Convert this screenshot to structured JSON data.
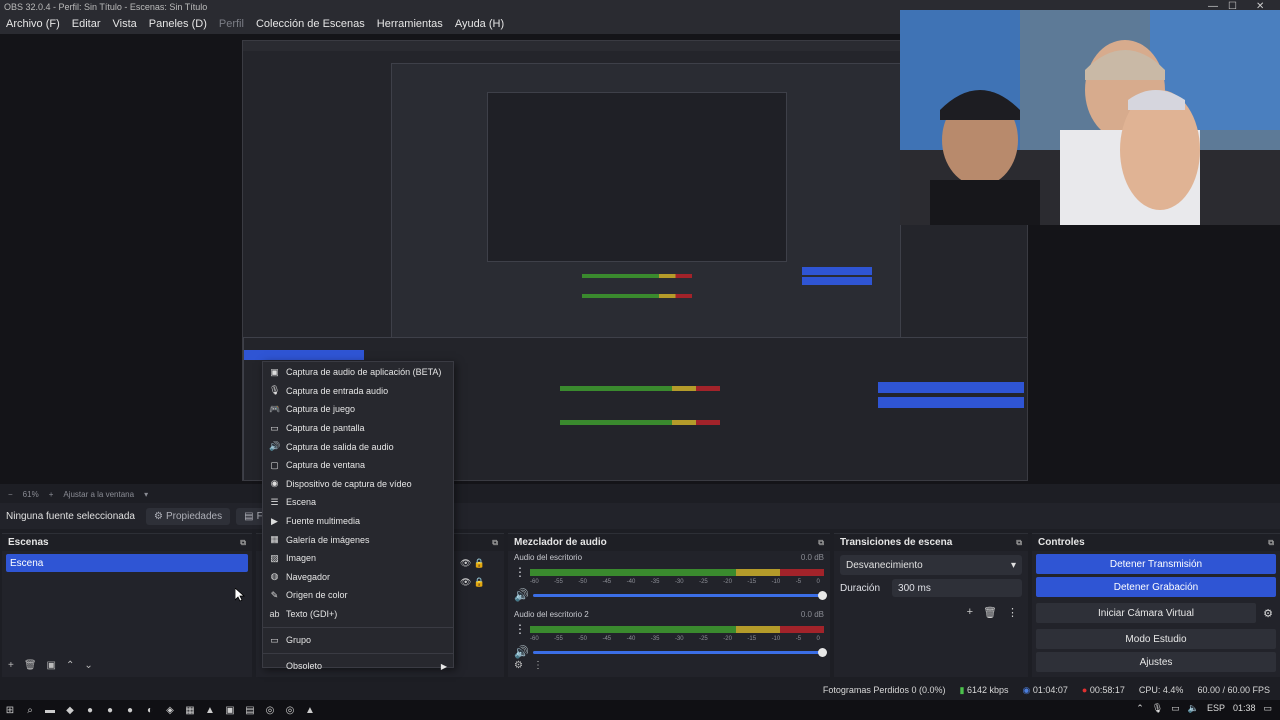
{
  "window": {
    "title": "OBS 32.0.4 - Perfil: Sin Título - Escenas: Sin Título"
  },
  "menubar": {
    "items": [
      {
        "label": "Archivo (F)",
        "dim": false
      },
      {
        "label": "Editar",
        "dim": false
      },
      {
        "label": "Vista",
        "dim": false
      },
      {
        "label": "Paneles (D)",
        "dim": false
      },
      {
        "label": "Perfil",
        "dim": true
      },
      {
        "label": "Colección de Escenas",
        "dim": false
      },
      {
        "label": "Herramientas",
        "dim": false
      },
      {
        "label": "Ayuda (H)",
        "dim": false
      }
    ]
  },
  "preview": {
    "zoom": "61%",
    "fit_label": "Ajustar a la ventana"
  },
  "properties_bar": {
    "no_source": "Ninguna fuente seleccionada",
    "properties_btn": "Propiedades",
    "filters_btn": "Filtros"
  },
  "scenes": {
    "title": "Escenas",
    "items": [
      "Escena"
    ]
  },
  "context_menu": {
    "items": [
      {
        "label": "Captura de audio de aplicación (BETA)",
        "icon": "app-audio-icon"
      },
      {
        "label": "Captura de entrada audio",
        "icon": "microphone-icon"
      },
      {
        "label": "Captura de juego",
        "icon": "gamepad-icon"
      },
      {
        "label": "Captura de pantalla",
        "icon": "monitor-icon"
      },
      {
        "label": "Captura de salida de audio",
        "icon": "speaker-icon"
      },
      {
        "label": "Captura de ventana",
        "icon": "window-icon"
      },
      {
        "label": "Dispositivo de captura de vídeo",
        "icon": "camera-icon"
      },
      {
        "label": "Escena",
        "icon": "list-icon"
      },
      {
        "label": "Fuente multimedia",
        "icon": "play-icon"
      },
      {
        "label": "Galería de imágenes",
        "icon": "slideshow-icon"
      },
      {
        "label": "Imagen",
        "icon": "image-icon"
      },
      {
        "label": "Navegador",
        "icon": "globe-icon"
      },
      {
        "label": "Origen de color",
        "icon": "brush-icon"
      },
      {
        "label": "Texto (GDI+)",
        "icon": "text-icon"
      },
      {
        "label": "Grupo",
        "icon": "folder-icon"
      },
      {
        "label": "Obsoleto",
        "icon": "none"
      }
    ]
  },
  "mixer": {
    "title": "Mezclador de audio",
    "channels": [
      {
        "name": "Audio del escritorio",
        "db": "0.0 dB"
      },
      {
        "name": "Audio del escritorio 2",
        "db": "0.0 dB"
      }
    ],
    "ticks": [
      "-60",
      "-55",
      "-50",
      "-45",
      "-40",
      "-35",
      "-30",
      "-25",
      "-20",
      "-15",
      "-10",
      "-5",
      "0"
    ]
  },
  "transitions": {
    "title": "Transiciones de escena",
    "selected": "Desvanecimiento",
    "duration_label": "Duración",
    "duration_value": "300 ms"
  },
  "controls": {
    "title": "Controles",
    "stop_stream": "Detener Transmisión",
    "stop_record": "Detener Grabación",
    "virtual_cam": "Iniciar Cámara Virtual",
    "studio_mode": "Modo Estudio",
    "settings": "Ajustes"
  },
  "status": {
    "dropped": "Fotogramas Perdidos 0 (0.0%)",
    "bitrate": "6142 kbps",
    "stream_time": "01:04:07",
    "rec_time": "00:58:17",
    "cpu": "CPU: 4.4%",
    "fps": "60.00 / 60.00 FPS"
  },
  "taskbar": {
    "lang": "ESP",
    "clock": "01:38"
  },
  "colors": {
    "accent": "#2f55d4",
    "bg": "#1d1e24",
    "panel": "#22232a"
  }
}
